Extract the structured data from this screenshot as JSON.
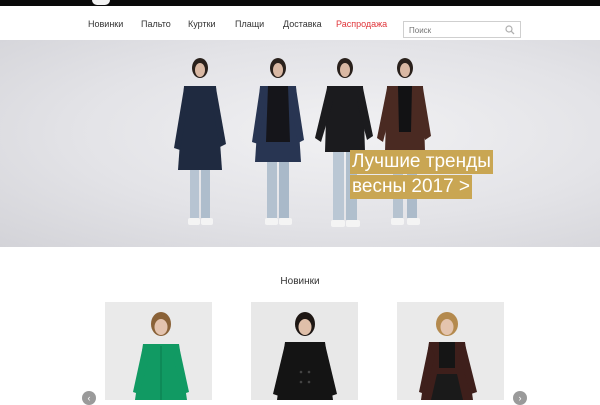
{
  "nav": {
    "items": [
      "Новинки",
      "Пальто",
      "Куртки",
      "Плащи",
      "Доставка",
      "Распродажа"
    ],
    "sale_color": "#e0353a"
  },
  "search": {
    "placeholder": "Поиск",
    "icon": "search-icon"
  },
  "hero": {
    "caption_line1": "Лучшие тренды",
    "caption_line2": "весны 2017 >",
    "caption_bg": "#c9a653"
  },
  "section": {
    "title": "Новинки"
  },
  "carousel": {
    "prev_icon": "chevron-left-icon",
    "next_icon": "chevron-right-icon",
    "prev_glyph": "‹",
    "next_glyph": "›"
  },
  "colors": {
    "topbar": "#0a0a0a",
    "accent": "#c9a653"
  }
}
